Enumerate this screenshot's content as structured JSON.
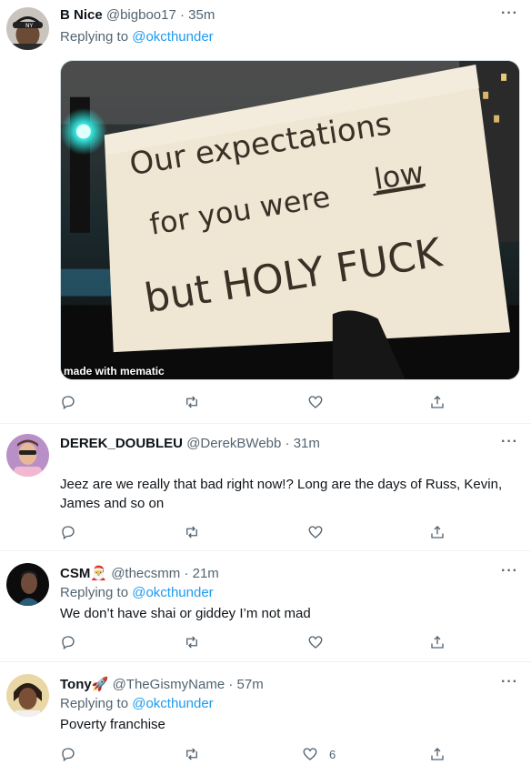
{
  "tweets": [
    {
      "name": "B Nice",
      "handle": "@bigboo17",
      "time": "35m",
      "reply_prefix": "Replying to",
      "reply_to": "@okcthunder",
      "image": {
        "sign_line1": "Our expectations",
        "sign_line2": "for you were",
        "sign_line2b": "low",
        "sign_line3": "but HOLY FUCK",
        "watermark": "made with mematic"
      }
    },
    {
      "name": "DEREK_DOUBLEU",
      "handle": "@DerekBWebb",
      "time": "31m",
      "text": "Jeez are we really that bad right now!? Long are the days of Russ, Kevin, James and so on"
    },
    {
      "name": "CSM🎅",
      "handle": "@thecsmm",
      "time": "21m",
      "reply_prefix": "Replying to",
      "reply_to": "@okcthunder",
      "text": "We don’t have shai or giddey I’m not mad"
    },
    {
      "name": "Tony🚀",
      "handle": "@TheGismyName",
      "time": "57m",
      "reply_prefix": "Replying to",
      "reply_to": "@okcthunder",
      "text": "Poverty franchise",
      "like_count": "6"
    }
  ],
  "ui": {
    "separator": "·",
    "more": "···"
  },
  "icons": [
    "reply-icon",
    "retweet-icon",
    "like-icon",
    "share-icon",
    "more-icon"
  ],
  "colors": {
    "link": "#1d9bf0",
    "muted": "#536471",
    "text": "#0f1419"
  }
}
